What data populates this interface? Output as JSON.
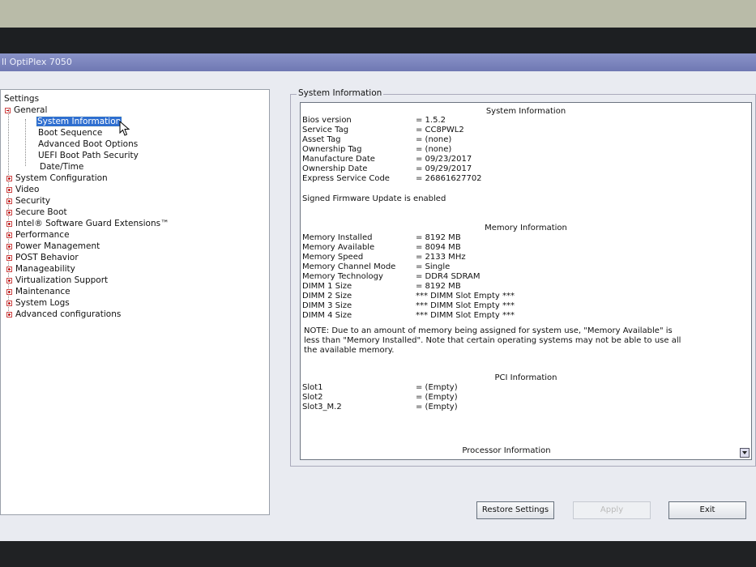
{
  "window": {
    "title": "ll OptiPlex 7050"
  },
  "tree": {
    "title": "Settings",
    "general": {
      "label": "General",
      "children": [
        {
          "label": "System Information",
          "selected": true
        },
        {
          "label": "Boot Sequence"
        },
        {
          "label": "Advanced Boot Options"
        },
        {
          "label": "UEFI Boot Path Security"
        },
        {
          "label": "Date/Time"
        }
      ]
    },
    "categories": [
      "System Configuration",
      "Video",
      "Security",
      "Secure Boot",
      "Intel® Software Guard Extensions™",
      "Performance",
      "Power Management",
      "POST Behavior",
      "Manageability",
      "Virtualization Support",
      "Maintenance",
      "System Logs",
      "Advanced configurations"
    ]
  },
  "panel": {
    "group_title": "System Information",
    "system": {
      "heading": "System Information",
      "rows": [
        {
          "key": "Bios version",
          "value": "= 1.5.2"
        },
        {
          "key": "Service Tag",
          "value": "= CC8PWL2"
        },
        {
          "key": "Asset Tag",
          "value": "= (none)"
        },
        {
          "key": "Ownership Tag",
          "value": "= (none)"
        },
        {
          "key": "Manufacture Date",
          "value": "= 09/23/2017"
        },
        {
          "key": "Ownership Date",
          "value": "= 09/29/2017"
        },
        {
          "key": "Express Service Code",
          "value": "= 26861627702"
        }
      ],
      "firmware_note": "Signed Firmware Update is enabled"
    },
    "memory": {
      "heading": "Memory Information",
      "rows": [
        {
          "key": "Memory Installed",
          "value": "= 8192 MB"
        },
        {
          "key": "Memory Available",
          "value": "= 8094 MB"
        },
        {
          "key": "Memory Speed",
          "value": "= 2133 MHz"
        },
        {
          "key": "Memory Channel Mode",
          "value": "= Single"
        },
        {
          "key": "Memory Technology",
          "value": "= DDR4 SDRAM"
        },
        {
          "key": "DIMM 1 Size",
          "value": "= 8192 MB"
        },
        {
          "key": "DIMM 2 Size",
          "value": "*** DIMM Slot Empty ***"
        },
        {
          "key": "DIMM 3 Size",
          "value": "*** DIMM Slot Empty ***"
        },
        {
          "key": "DIMM 4 Size",
          "value": "*** DIMM Slot Empty ***"
        }
      ],
      "note": "NOTE: Due to an amount of memory being assigned for system use, \"Memory Available\" is less than \"Memory Installed\". Note that certain operating systems may not be able to use all the available memory."
    },
    "pci": {
      "heading": "PCI Information",
      "rows": [
        {
          "key": "Slot1",
          "value": "= (Empty)"
        },
        {
          "key": "Slot2",
          "value": "= (Empty)"
        },
        {
          "key": "Slot3_M.2",
          "value": "= (Empty)"
        }
      ]
    },
    "processor": {
      "heading": "Processor Information"
    }
  },
  "buttons": {
    "restore": "Restore Settings",
    "apply": "Apply",
    "exit": "Exit"
  }
}
